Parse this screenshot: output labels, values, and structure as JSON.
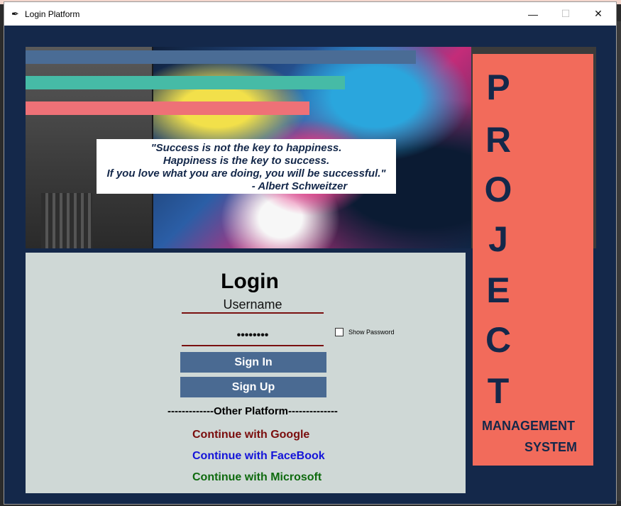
{
  "window": {
    "title": "Login Platform",
    "icon": "feather-icon",
    "controls": {
      "minimize": "—",
      "maximize": "☐",
      "close": "✕"
    }
  },
  "quote": {
    "line1": "\"Success is not the key to happiness.",
    "line2": "Happiness is the key to success.",
    "line3": "If you love what you are doing, you will be successful.\"",
    "author": "- Albert Schweitzer"
  },
  "banner": {
    "letters": [
      "P",
      "R",
      "O",
      "J",
      "E",
      "C",
      "T"
    ],
    "sub1": "MANAGEMENT",
    "sub2": "SYSTEM"
  },
  "login": {
    "title": "Login",
    "username_value": "Username",
    "password_value": "••••••••",
    "show_password_label": "Show Password",
    "show_password_checked": false,
    "signin_label": "Sign In",
    "signup_label": "Sign Up",
    "other_platform": "-------------Other Platform--------------",
    "google": "Continue with Google",
    "facebook": "Continue with FaceBook",
    "microsoft": "Continue with Microsoft"
  },
  "colors": {
    "window_bg": "#14284a",
    "banner": "#f26b5b",
    "panel": "#cfd8d6",
    "button": "#4a6a92",
    "bar_blue": "#4a6c95",
    "bar_teal": "#46bba6",
    "bar_pink": "#ee7177"
  }
}
